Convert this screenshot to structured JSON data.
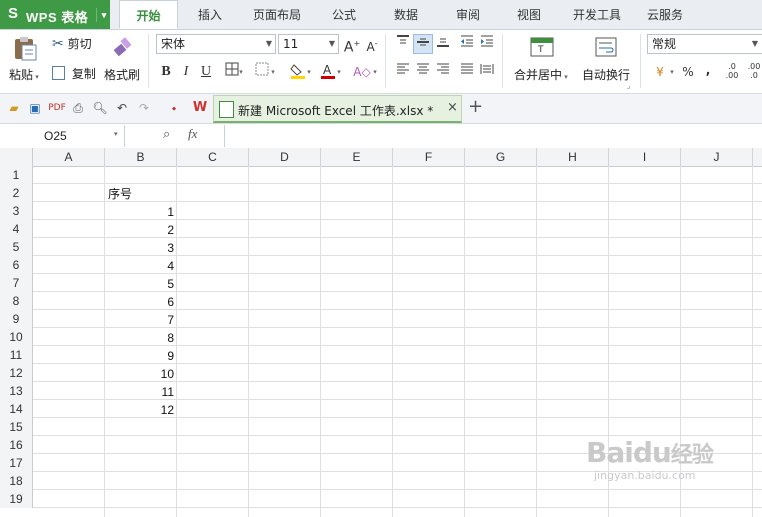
{
  "app": {
    "logo": "S",
    "name": "WPS 表格"
  },
  "menu_tabs": [
    "开始",
    "插入",
    "页面布局",
    "公式",
    "数据",
    "审阅",
    "视图",
    "开发工具",
    "云服务"
  ],
  "ribbon": {
    "paste": "粘贴",
    "cut": "剪切",
    "copy": "复制",
    "format_painter": "格式刷",
    "font_name": "宋体",
    "font_size": "11",
    "merge_center": "合并居中",
    "wrap_text": "自动换行",
    "number_format": "常规",
    "percent": "%",
    "comma": ","
  },
  "document_tab": {
    "title": "新建 Microsoft Excel 工作表.xlsx *"
  },
  "formula_bar": {
    "name_box": "O25",
    "fx": "fx",
    "content": ""
  },
  "sheet": {
    "columns": [
      "A",
      "B",
      "C",
      "D",
      "E",
      "F",
      "G",
      "H",
      "I",
      "J"
    ],
    "rows": [
      "1",
      "2",
      "3",
      "4",
      "5",
      "6",
      "7",
      "8",
      "9",
      "10",
      "11",
      "12",
      "13",
      "14",
      "15",
      "16",
      "17",
      "18",
      "19"
    ],
    "header_cell": {
      "ref": "B2",
      "value": "序号"
    },
    "values": [
      {
        "ref": "B3",
        "value": "1"
      },
      {
        "ref": "B4",
        "value": "2"
      },
      {
        "ref": "B5",
        "value": "3"
      },
      {
        "ref": "B6",
        "value": "4"
      },
      {
        "ref": "B7",
        "value": "5"
      },
      {
        "ref": "B8",
        "value": "6"
      },
      {
        "ref": "B9",
        "value": "7"
      },
      {
        "ref": "B10",
        "value": "8"
      },
      {
        "ref": "B11",
        "value": "9"
      },
      {
        "ref": "B12",
        "value": "10"
      },
      {
        "ref": "B13",
        "value": "11"
      },
      {
        "ref": "B14",
        "value": "12"
      }
    ]
  },
  "watermark": {
    "brand": "Baidu",
    "brand_cn": "经验",
    "url": "jingyan.baidu.com"
  },
  "colors": {
    "wps_green": "#3f9a45",
    "ribbon_bg": "#ffffff",
    "menubar_bg": "#eaeef3",
    "grid_line": "#dcdfe3"
  }
}
